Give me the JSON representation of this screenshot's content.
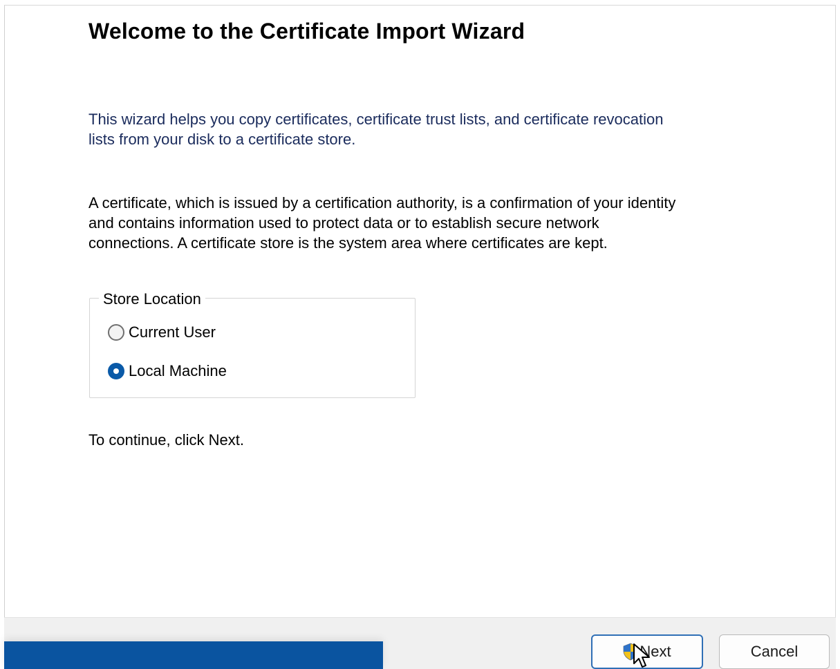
{
  "wizard": {
    "title": "Welcome to the Certificate Import Wizard",
    "intro": "This wizard helps you copy certificates, certificate trust lists, and certificate revocation\nlists from your disk to a certificate store.",
    "description": "A certificate, which is issued by a certification authority, is a confirmation of your identity\nand contains information used to protect data or to establish secure network\nconnections. A certificate store is the system area where certificates are kept.",
    "continue_hint": "To continue, click Next."
  },
  "store_location": {
    "legend": "Store Location",
    "options": [
      {
        "label": "Current User",
        "selected": false
      },
      {
        "label": "Local Machine",
        "selected": true
      }
    ]
  },
  "footer": {
    "next_label": "Next",
    "cancel_label": "Cancel"
  },
  "colors": {
    "accent": "#0a5aa8",
    "taskbar": "#0a54a0",
    "intro_text": "#1a2b5c"
  },
  "icons": {
    "next_button_icon": "uac-shield-icon",
    "pointer": "mouse-cursor-icon"
  }
}
